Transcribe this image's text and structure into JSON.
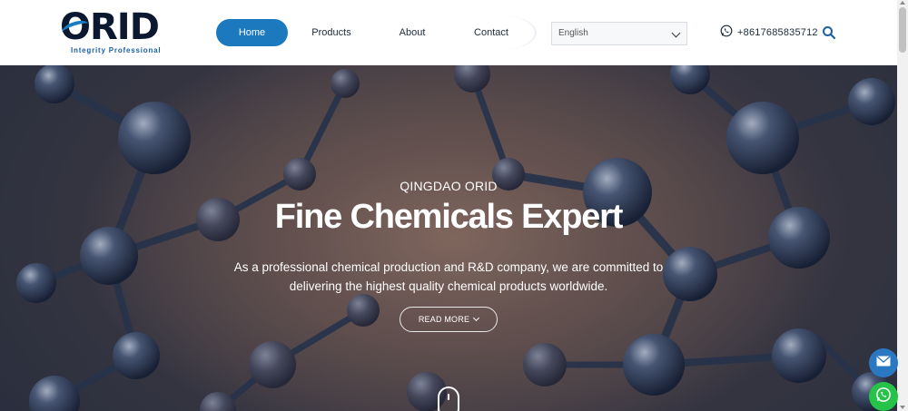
{
  "brand": {
    "logo_text": "ORID",
    "tagline": "Integrity  Professional"
  },
  "nav": {
    "items": [
      {
        "label": "Home",
        "active": true
      },
      {
        "label": "Products",
        "active": false
      },
      {
        "label": "About",
        "active": false
      },
      {
        "label": "Contact",
        "active": false
      }
    ]
  },
  "language": {
    "selected": "English"
  },
  "contact": {
    "phone": "+8617685835712",
    "phone_icon": "whatsapp-icon",
    "search_icon": "search-icon"
  },
  "hero": {
    "kicker": "QINGDAO ORID",
    "title": "Fine Chemicals Expert",
    "description": "As a professional chemical production and R&D company, we are committed to delivering the highest quality chemical products worldwide.",
    "cta_label": "READ MORE"
  },
  "floating": {
    "mail_icon": "mail-icon",
    "whatsapp_icon": "whatsapp-icon"
  },
  "colors": {
    "accent": "#1d79be",
    "whatsapp": "#27c24a",
    "mail": "#2a78c2",
    "logo_dark": "#0b1830"
  }
}
